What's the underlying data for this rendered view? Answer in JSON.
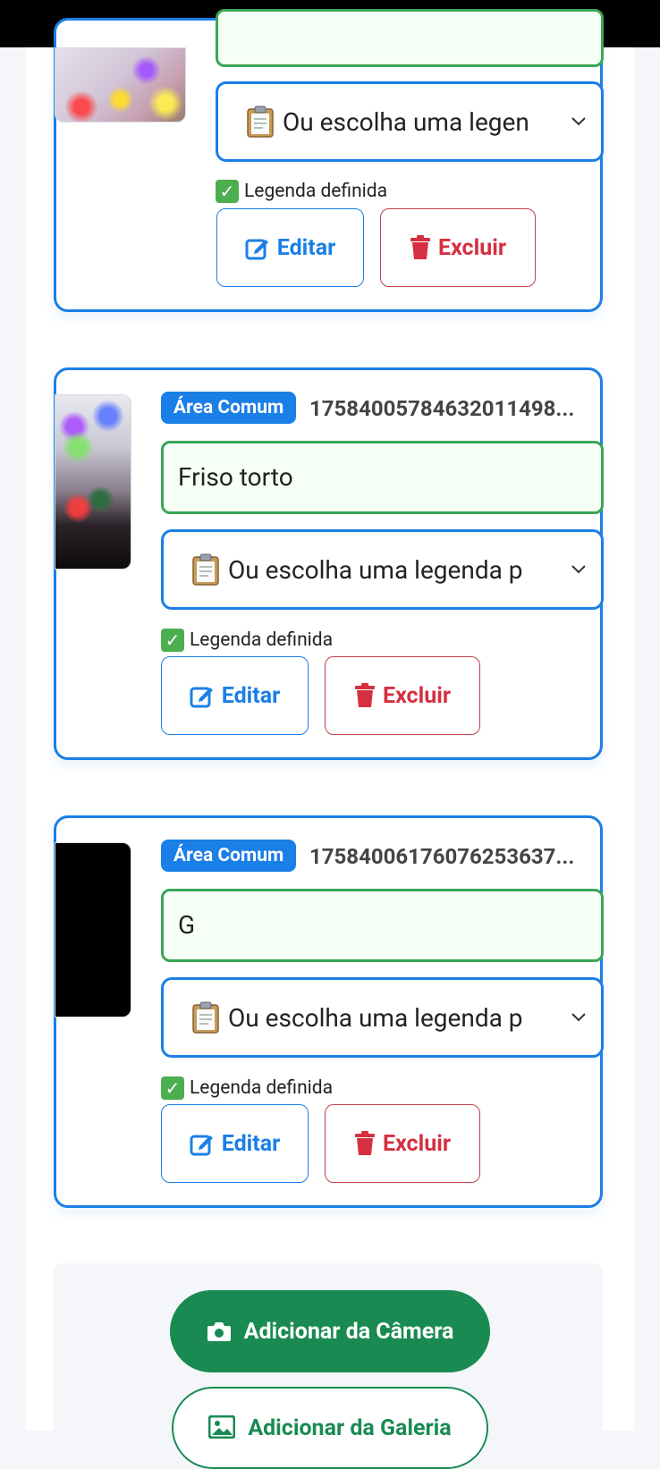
{
  "colors": {
    "primary": "#1a7fe6",
    "success": "#3aa655",
    "danger": "#d62f41",
    "camera_button": "#198b52"
  },
  "photos": [
    {
      "area_badge": "",
      "file_id": "",
      "caption_value": "",
      "select_value": "Ou escolha uma legen",
      "status_text": "Legenda definida",
      "edit_label": "Editar",
      "delete_label": "Excluir"
    },
    {
      "area_badge": "Área Comum",
      "file_id": "17584005784632011498...",
      "caption_value": "Friso torto",
      "select_value": "Ou escolha uma legenda p",
      "status_text": "Legenda definida",
      "edit_label": "Editar",
      "delete_label": "Excluir"
    },
    {
      "area_badge": "Área Comum",
      "file_id": "17584006176076253637...",
      "caption_value": "G",
      "select_value": "Ou escolha uma legenda p",
      "status_text": "Legenda definida",
      "edit_label": "Editar",
      "delete_label": "Excluir"
    }
  ],
  "actions": {
    "camera_label": "Adicionar da Câmera",
    "gallery_label": "Adicionar da Galeria"
  },
  "icons": {
    "select": "clipboard-icon",
    "status": "check-box-icon",
    "edit": "pen-square-icon",
    "delete": "trash-icon",
    "camera": "camera-icon",
    "gallery": "image-icon"
  }
}
